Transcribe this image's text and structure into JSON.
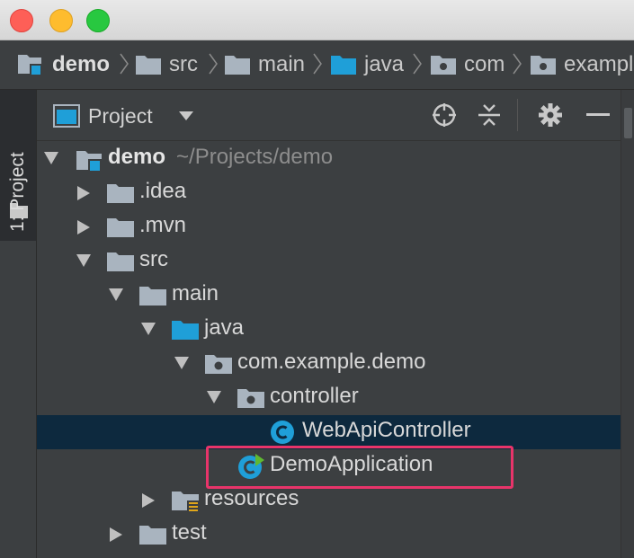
{
  "window": {
    "buttons": [
      "close",
      "minimize",
      "zoom"
    ]
  },
  "navbar": {
    "crumbs": [
      {
        "label": "demo",
        "icon": "module-folder-icon"
      },
      {
        "label": "src",
        "icon": "folder-icon"
      },
      {
        "label": "main",
        "icon": "folder-icon"
      },
      {
        "label": "java",
        "icon": "source-folder-icon"
      },
      {
        "label": "com",
        "icon": "package-icon"
      },
      {
        "label": "exampl",
        "icon": "package-icon"
      }
    ]
  },
  "sidebar": {
    "tab_label": "1: Project"
  },
  "panel": {
    "title": "Project",
    "toolbar": [
      "locate-icon",
      "collapse-all-icon",
      "gear-icon",
      "hide-icon"
    ]
  },
  "tree": [
    {
      "label": "demo",
      "path": "~/Projects/demo",
      "expanded": true,
      "level": 0,
      "icon": "module-folder-icon"
    },
    {
      "label": ".idea",
      "expanded": false,
      "level": 1,
      "icon": "folder-icon"
    },
    {
      "label": ".mvn",
      "expanded": false,
      "level": 1,
      "icon": "folder-icon"
    },
    {
      "label": "src",
      "expanded": true,
      "level": 1,
      "icon": "folder-icon"
    },
    {
      "label": "main",
      "expanded": true,
      "level": 2,
      "icon": "folder-icon"
    },
    {
      "label": "java",
      "expanded": true,
      "level": 3,
      "icon": "source-folder-icon"
    },
    {
      "label": "com.example.demo",
      "expanded": true,
      "level": 4,
      "icon": "package-icon"
    },
    {
      "label": "controller",
      "expanded": true,
      "level": 5,
      "icon": "package-icon"
    },
    {
      "label": "WebApiController",
      "level": 6,
      "icon": "class-icon",
      "selected": true
    },
    {
      "label": "DemoApplication",
      "level": 5,
      "icon": "spring-boot-class-icon",
      "highlighted": true
    },
    {
      "label": "resources",
      "expanded": false,
      "level": 3,
      "icon": "resources-folder-icon"
    },
    {
      "label": "test",
      "expanded": false,
      "level": 2,
      "icon": "folder-icon"
    }
  ],
  "colors": {
    "background": "#3c3f41",
    "selection": "#0d293e",
    "highlight": "#e8346a",
    "accent": "#1f9fd8"
  }
}
